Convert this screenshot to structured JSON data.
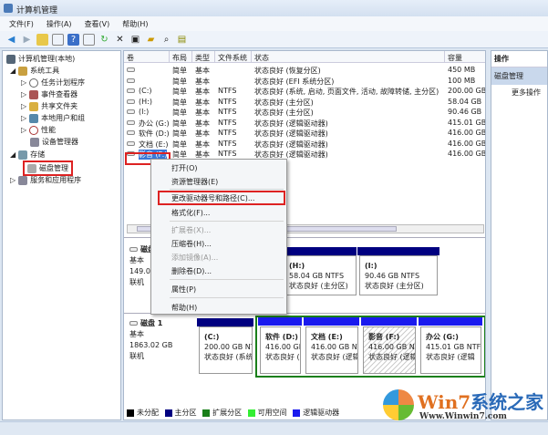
{
  "window": {
    "title": "计算机管理"
  },
  "menu": [
    "文件(F)",
    "操作(A)",
    "查看(V)",
    "帮助(H)"
  ],
  "tree": {
    "root": "计算机管理(本地)",
    "system_tools": "系统工具",
    "task_scheduler": "任务计划程序",
    "event_viewer": "事件查看器",
    "shared_folders": "共享文件夹",
    "local_users": "本地用户和组",
    "performance": "性能",
    "device_manager": "设备管理器",
    "storage": "存储",
    "disk_management": "磁盘管理",
    "services": "服务和应用程序"
  },
  "table": {
    "headers": [
      "卷",
      "布局",
      "类型",
      "文件系统",
      "状态",
      "容量"
    ],
    "rows": [
      [
        "",
        "简单",
        "基本",
        "",
        "状态良好 (恢复分区)",
        "450 MB"
      ],
      [
        "",
        "简单",
        "基本",
        "",
        "状态良好 (EFI 系统分区)",
        "100 MB"
      ],
      [
        "(C:)",
        "简单",
        "基本",
        "NTFS",
        "状态良好 (系统, 启动, 页面文件, 活动, 故障转储, 主分区)",
        "200.00 GB"
      ],
      [
        "(H:)",
        "简单",
        "基本",
        "NTFS",
        "状态良好 (主分区)",
        "58.04 GB"
      ],
      [
        "(I:)",
        "简单",
        "基本",
        "NTFS",
        "状态良好 (主分区)",
        "90.46 GB"
      ],
      [
        "办公 (G:)",
        "简单",
        "基本",
        "NTFS",
        "状态良好 (逻辑驱动器)",
        "415.01 GB"
      ],
      [
        "软件 (D:)",
        "简单",
        "基本",
        "NTFS",
        "状态良好 (逻辑驱动器)",
        "416.00 GB"
      ],
      [
        "文档 (E:)",
        "简单",
        "基本",
        "NTFS",
        "状态良好 (逻辑驱动器)",
        "416.00 GB"
      ],
      [
        "影音 (F:)",
        "简单",
        "基本",
        "NTFS",
        "状态良好 (逻辑驱动器)",
        "416.00 GB"
      ]
    ]
  },
  "actions": {
    "header": "操作",
    "section": "磁盘管理",
    "more": "更多操作"
  },
  "context_menu": {
    "open": "打开(O)",
    "explorer": "资源管理器(E)",
    "change_letter": "更改驱动器号和路径(C)...",
    "format": "格式化(F)...",
    "extend": "扩展卷(X)...",
    "shrink": "压缩卷(H)...",
    "mirror": "添加镜像(A)...",
    "delete": "删除卷(D)...",
    "properties": "属性(P)",
    "help": "帮助(H)"
  },
  "disk0": {
    "name": "磁盘 0",
    "type": "基本",
    "size": "149.04 GB",
    "status": "联机",
    "parts": [
      {
        "name": "(H:)",
        "size": "58.04 GB NTFS",
        "status": "状态良好 (主分区)"
      },
      {
        "name": "(I:)",
        "size": "90.46 GB NTFS",
        "status": "状态良好 (主分区)"
      }
    ]
  },
  "disk1": {
    "name": "磁盘 1",
    "type": "基本",
    "size": "1863.02 GB",
    "status": "联机",
    "parts": [
      {
        "name": "(C:)",
        "size": "200.00 GB NTFS",
        "status": "状态良好 (系统"
      },
      {
        "name": "软件 (D:)",
        "size": "416.00 GB NTFS",
        "status": "状态良好 (逻辑"
      },
      {
        "name": "文档 (E:)",
        "size": "416.00 GB NTFS",
        "status": "状态良好 (逻辑"
      },
      {
        "name": "影音 (F:)",
        "size": "416.00 GB NTFS",
        "status": "状态良好 (逻辑"
      },
      {
        "name": "办公 (G:)",
        "size": "415.01 GB NTFS",
        "status": "状态良好 (逻辑"
      }
    ]
  },
  "legend": [
    {
      "label": "未分配",
      "color": "#000000"
    },
    {
      "label": "主分区",
      "color": "#000080"
    },
    {
      "label": "扩展分区",
      "color": "#1a7f1a"
    },
    {
      "label": "可用空间",
      "color": "#33ee33"
    },
    {
      "label": "逻辑驱动器",
      "color": "#1a1aee"
    }
  ],
  "watermark": {
    "brand": "Win7系统之家",
    "url": "Www.Winwin7.com"
  }
}
